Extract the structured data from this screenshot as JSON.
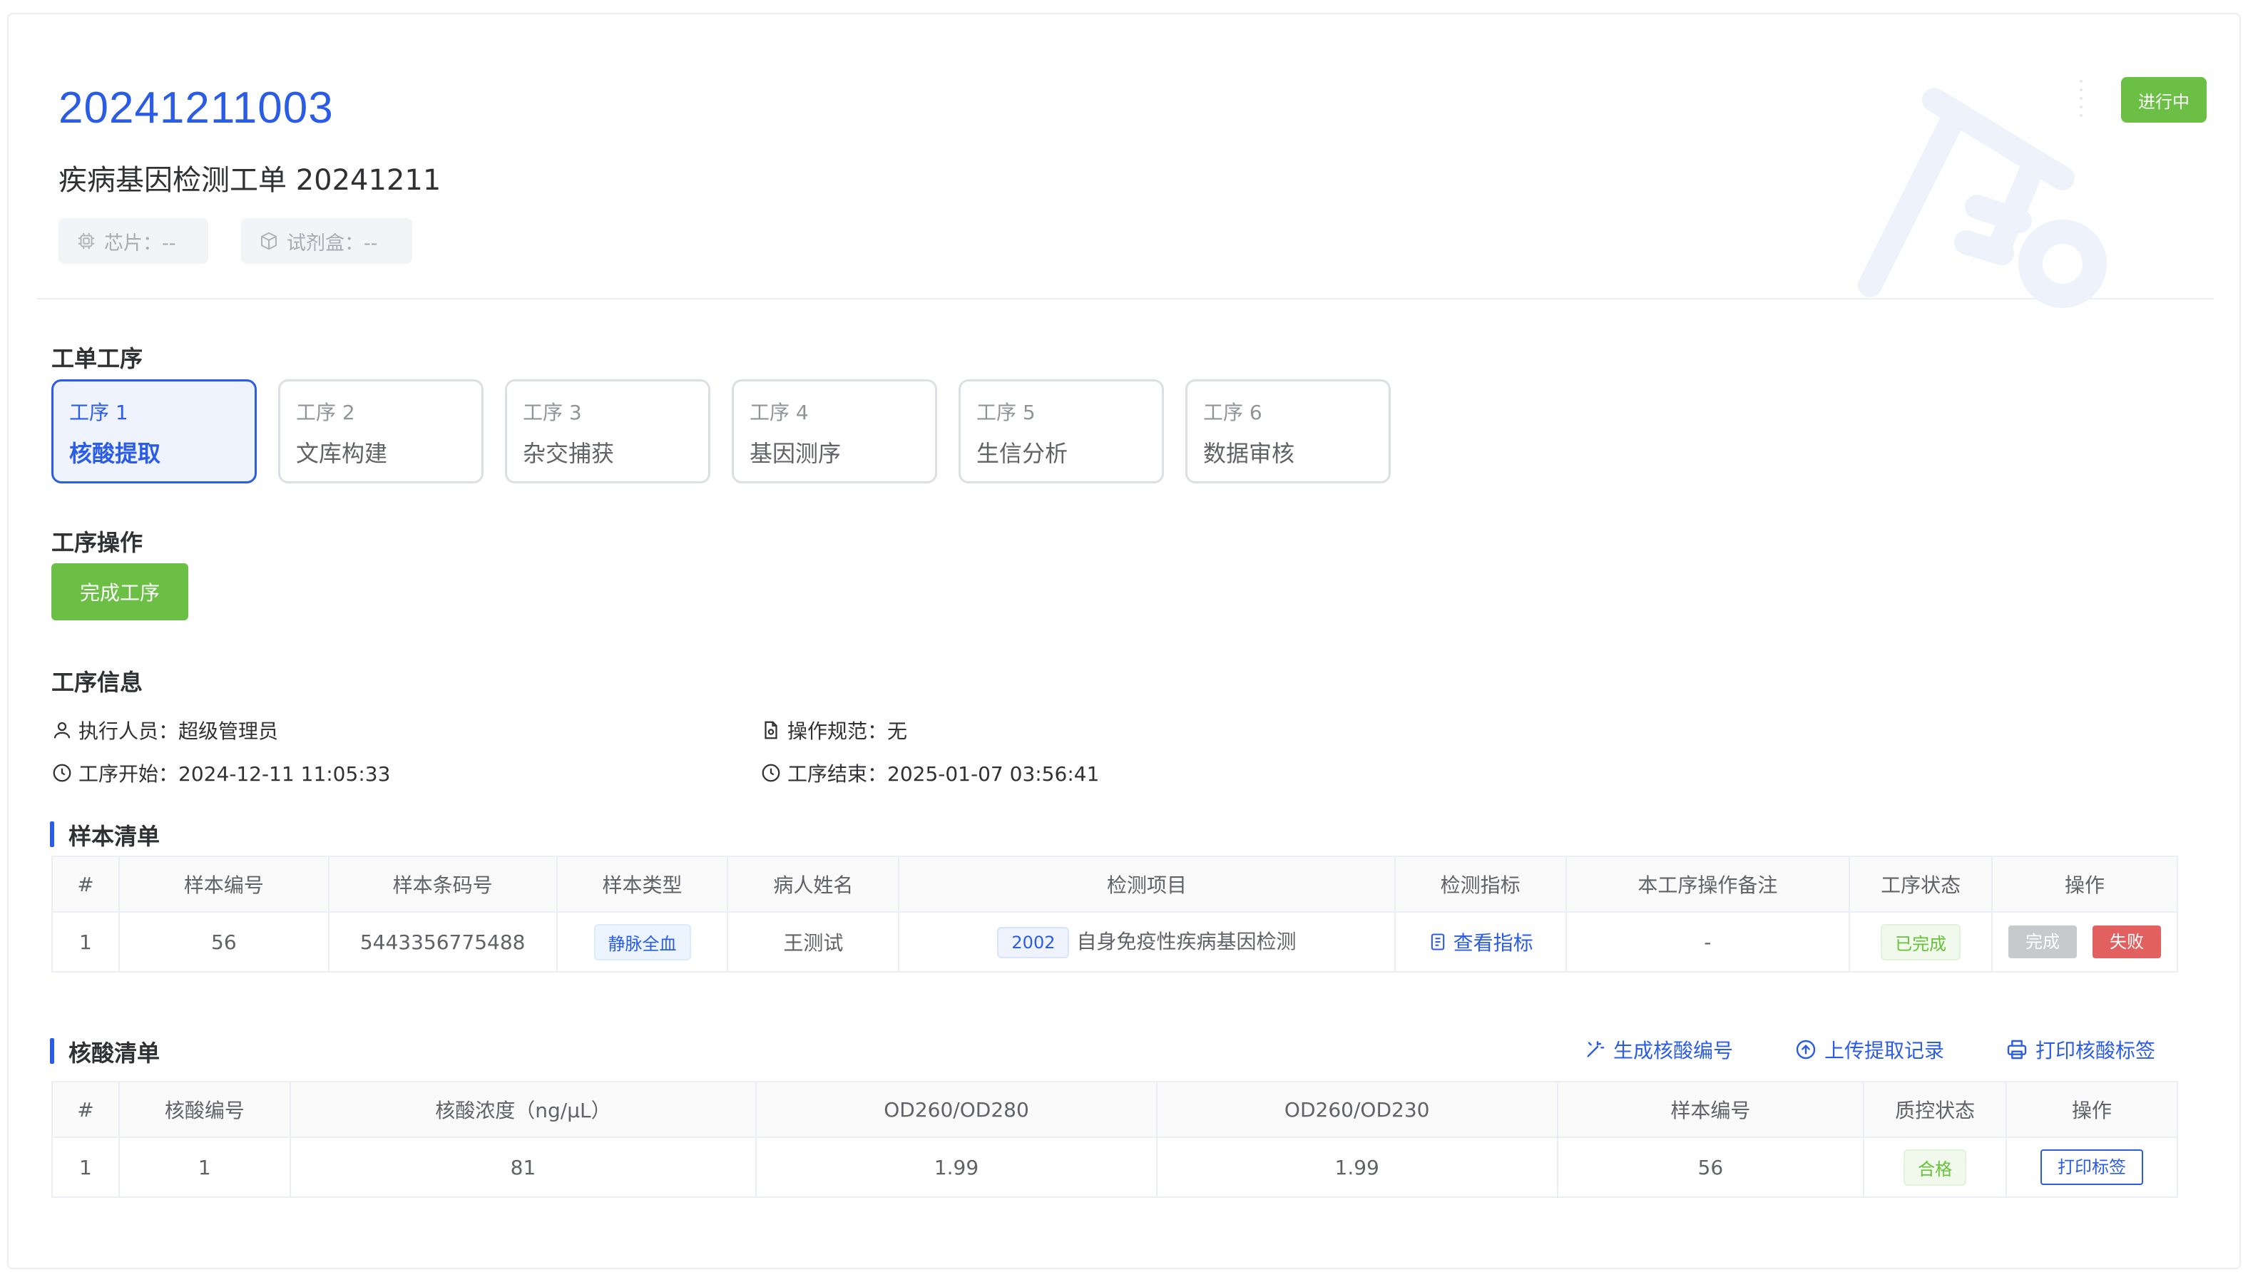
{
  "header": {
    "order_no": "20241211003",
    "order_name": "疾病基因检测工单 20241211",
    "chip_label": "芯片：--",
    "kit_label": "试剂盒：--",
    "status": "进行中"
  },
  "sections": {
    "steps_title": "工单工序",
    "ops_title": "工序操作",
    "info_title": "工序信息",
    "samples_title": "样本清单",
    "nucleic_title": "核酸清单"
  },
  "steps": [
    {
      "no": "工序 1",
      "name": "核酸提取"
    },
    {
      "no": "工序 2",
      "name": "文库构建"
    },
    {
      "no": "工序 3",
      "name": "杂交捕获"
    },
    {
      "no": "工序 4",
      "name": "基因测序"
    },
    {
      "no": "工序 5",
      "name": "生信分析"
    },
    {
      "no": "工序 6",
      "name": "数据审核"
    }
  ],
  "complete_button": "完成工序",
  "info": {
    "operator": "执行人员：超级管理员",
    "spec": "操作规范：无",
    "start": "工序开始：2024-12-11 11:05:33",
    "end": "工序结束：2025-01-07 03:56:41"
  },
  "samples": {
    "headers": [
      "#",
      "样本编号",
      "样本条码号",
      "样本类型",
      "病人姓名",
      "检测项目",
      "检测指标",
      "本工序操作备注",
      "工序状态",
      "操作"
    ],
    "rows": [
      {
        "index": "1",
        "sample_no": "56",
        "barcode": "5443356775488",
        "type": "静脉全血",
        "patient": "王测试",
        "project_code": "2002",
        "project_name": "自身免疫性疾病基因检测",
        "indicator_link": "查看指标",
        "remark": "-",
        "status": "已完成",
        "btn_done": "完成",
        "btn_fail": "失败"
      }
    ]
  },
  "nucleic_actions": {
    "generate": "生成核酸编号",
    "upload": "上传提取记录",
    "print": "打印核酸标签"
  },
  "nucleic": {
    "headers": [
      "#",
      "核酸编号",
      "核酸浓度（ng/μL）",
      "OD260/OD280",
      "OD260/OD230",
      "样本编号",
      "质控状态",
      "操作"
    ],
    "rows": [
      {
        "index": "1",
        "nucleic_no": "1",
        "concentration": "81",
        "od280": "1.99",
        "od230": "1.99",
        "sample_no": "56",
        "qc": "合格",
        "print_btn": "打印标签"
      }
    ]
  },
  "colors": {
    "primary": "#2b5ce6",
    "success": "#6bbf44",
    "danger": "#e36060",
    "disabled": "#c8c9cc"
  }
}
